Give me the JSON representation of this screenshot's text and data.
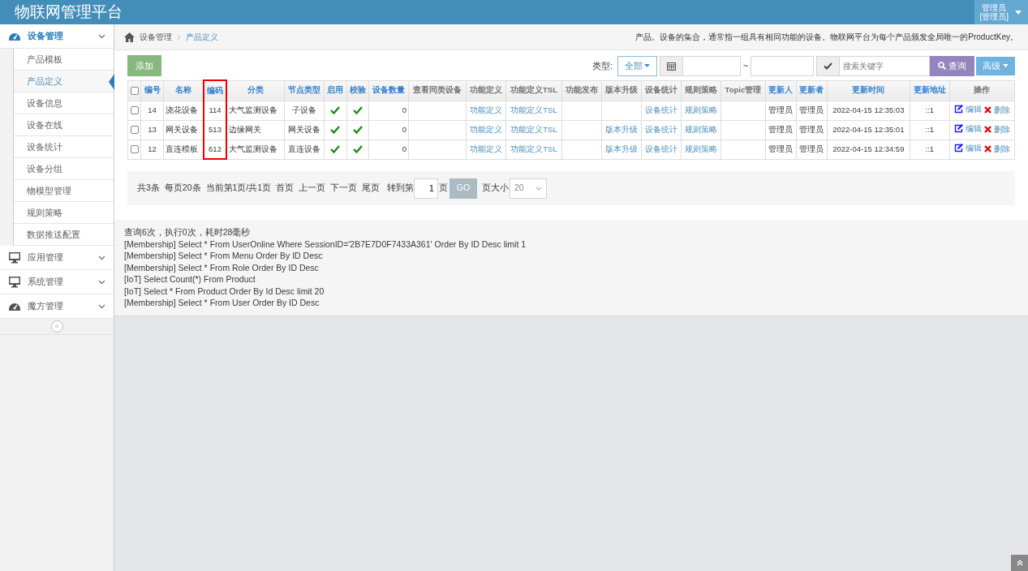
{
  "header": {
    "title": "物联网管理平台",
    "user_lines": [
      "管理员",
      "[管理员]"
    ]
  },
  "sidebar": {
    "groups": [
      {
        "label": "设备管理",
        "expanded": true,
        "children": [
          {
            "label": "产品模板",
            "selected": false
          },
          {
            "label": "产品定义",
            "selected": true
          },
          {
            "label": "设备信息",
            "selected": false
          },
          {
            "label": "设备在线",
            "selected": false
          },
          {
            "label": "设备统计",
            "selected": false
          },
          {
            "label": "设备分组",
            "selected": false
          },
          {
            "label": "物模型管理",
            "selected": false
          },
          {
            "label": "规则策略",
            "selected": false
          },
          {
            "label": "数据推送配置",
            "selected": false
          }
        ]
      },
      {
        "label": "应用管理",
        "expanded": false
      },
      {
        "label": "系统管理",
        "expanded": false
      },
      {
        "label": "魔方管理",
        "expanded": false
      }
    ],
    "collapse_button": "«"
  },
  "breadcrumb": {
    "items": [
      "设备管理",
      "产品定义"
    ],
    "description": "产品。设备的集合，通常指一组具有相同功能的设备。物联网平台为每个产品颁发全局唯一的ProductKey。"
  },
  "toolbar": {
    "add_button": "添加",
    "type_label": "类型:",
    "type_dropdown": "全部",
    "date_separator": "~",
    "search_placeholder": "搜索关键字",
    "search_button": "查询",
    "advanced_button": "高级"
  },
  "table": {
    "select_all_checked": false,
    "columns": [
      {
        "label": "编号",
        "sortable": true,
        "highlighted": false
      },
      {
        "label": "名称",
        "sortable": true,
        "highlighted": false
      },
      {
        "label": "编码",
        "sortable": true,
        "highlighted": true
      },
      {
        "label": "分类",
        "sortable": true,
        "highlighted": false
      },
      {
        "label": "节点类型",
        "sortable": true,
        "highlighted": false
      },
      {
        "label": "启用",
        "sortable": true,
        "highlighted": false
      },
      {
        "label": "校验",
        "sortable": true,
        "highlighted": false
      },
      {
        "label": "设备数量",
        "sortable": true,
        "highlighted": false
      },
      {
        "label": "查看同类设备",
        "sortable": false,
        "highlighted": false
      },
      {
        "label": "功能定义",
        "sortable": false,
        "highlighted": false
      },
      {
        "label": "功能定义TSL",
        "sortable": false,
        "highlighted": false
      },
      {
        "label": "功能发布",
        "sortable": false,
        "highlighted": false
      },
      {
        "label": "版本升级",
        "sortable": false,
        "highlighted": false
      },
      {
        "label": "设备统计",
        "sortable": false,
        "highlighted": false
      },
      {
        "label": "规则策略",
        "sortable": false,
        "highlighted": false
      },
      {
        "label": "Topic管理",
        "sortable": false,
        "highlighted": false
      },
      {
        "label": "更新人",
        "sortable": true,
        "highlighted": false
      },
      {
        "label": "更新者",
        "sortable": true,
        "highlighted": false
      },
      {
        "label": "更新时间",
        "sortable": true,
        "highlighted": false
      },
      {
        "label": "更新地址",
        "sortable": true,
        "highlighted": false
      },
      {
        "label": "操作",
        "sortable": false,
        "highlighted": false
      }
    ],
    "rows": [
      {
        "checked": false,
        "id": "14",
        "name": "浇花设备",
        "code": "114",
        "category": "大气监测设备",
        "node_type": "子设备",
        "enabled": true,
        "verified": true,
        "device_count": "0",
        "func_def": "功能定义",
        "func_tsl": "功能定义TSL",
        "stats": "设备统计",
        "rules": "规则策略",
        "updater": "管理员",
        "updater2": "管理员",
        "time": "2022-04-15 12:35:03",
        "address": "::1",
        "edit": "编辑",
        "delete": "删除"
      },
      {
        "checked": false,
        "id": "13",
        "name": "网关设备",
        "code": "513",
        "category": "边缘网关",
        "node_type": "网关设备",
        "enabled": true,
        "verified": true,
        "device_count": "0",
        "func_def": "功能定义",
        "func_tsl": "功能定义TSL",
        "upgrade": "版本升级",
        "stats": "设备统计",
        "rules": "规则策略",
        "updater": "管理员",
        "updater2": "管理员",
        "time": "2022-04-15 12:35:01",
        "address": "::1",
        "edit": "编辑",
        "delete": "删除"
      },
      {
        "checked": false,
        "id": "12",
        "name": "直连模板",
        "code": "612",
        "category": "大气监测设备",
        "node_type": "直连设备",
        "enabled": true,
        "verified": true,
        "device_count": "0",
        "func_def": "功能定义",
        "func_tsl": "功能定义TSL",
        "upgrade": "版本升级",
        "stats": "设备统计",
        "rules": "规则策略",
        "updater": "管理员",
        "updater2": "管理员",
        "time": "2022-04-15 12:34:59",
        "address": "::1",
        "edit": "编辑",
        "delete": "删除"
      }
    ]
  },
  "pager": {
    "items": [
      "共3条",
      "每页20条",
      "当前第1页/共1页",
      "首页",
      "上一页",
      "下一页",
      "尾页"
    ],
    "goto_label": "转到第",
    "page_value": "1",
    "page_suffix": "页",
    "go_button": "GO",
    "size_label": "页大小",
    "size_value": "20"
  },
  "log": [
    "查询6次，执行0次，耗时28毫秒",
    "[Membership] Select * From UserOnline Where SessionID='2B7E7D0F7433A361' Order By ID Desc limit 1",
    "[Membership] Select * From Menu Order By ID Desc",
    "[Membership] Select * From Role Order By ID Desc",
    "[IoT] Select Count(*) From Product",
    "[IoT] Select * From Product Order By Id Desc limit 20",
    "[Membership] Select * From User Order By ID Desc"
  ]
}
